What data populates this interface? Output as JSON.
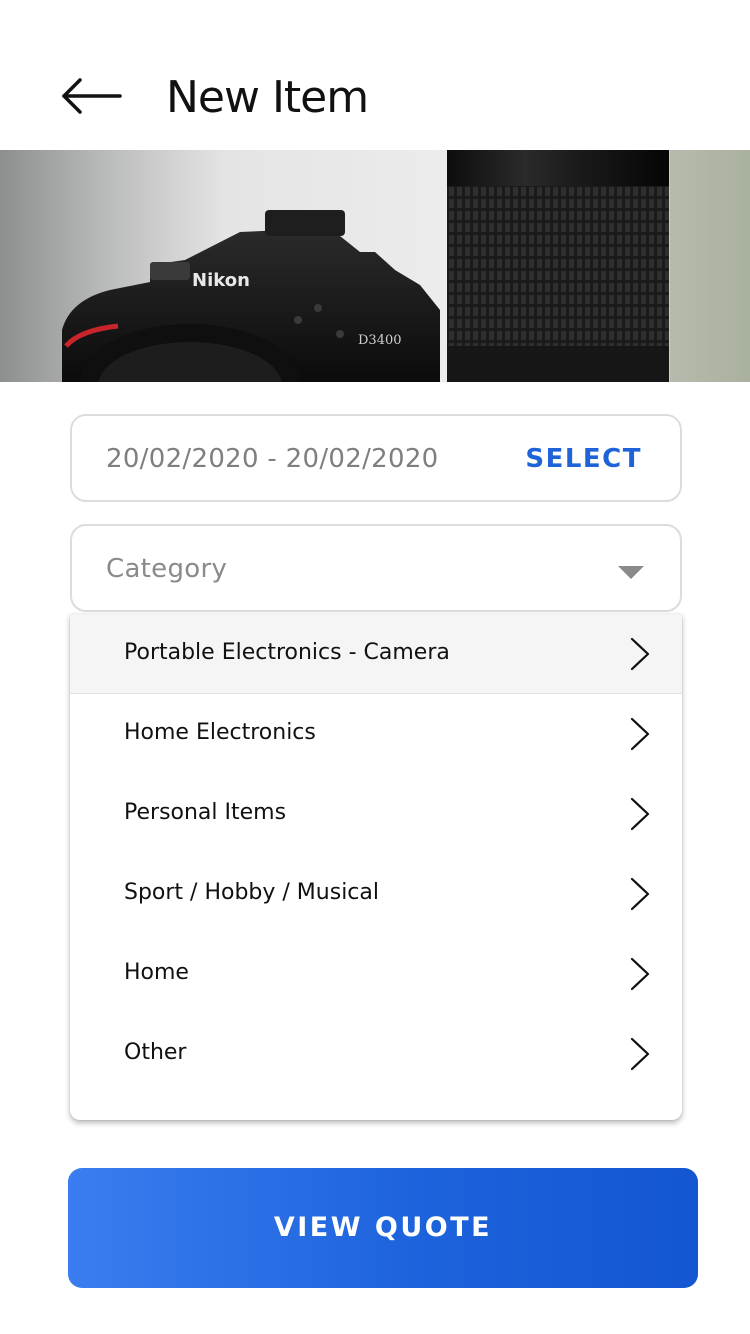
{
  "header": {
    "title": "New Item",
    "back_icon": "arrow-left-icon"
  },
  "hero": {
    "brand_text": "Nikon",
    "model_text": "D3400"
  },
  "date_field": {
    "value": "20/02/2020 - 20/02/2020",
    "select_label": "SELECT"
  },
  "category_field": {
    "placeholder": "Category",
    "icon": "caret-down-icon"
  },
  "category_options": [
    {
      "label": "Portable Electronics - Camera",
      "highlighted": true
    },
    {
      "label": "Home Electronics",
      "highlighted": false
    },
    {
      "label": "Personal Items",
      "highlighted": false
    },
    {
      "label": "Sport / Hobby / Musical",
      "highlighted": false
    },
    {
      "label": "Home",
      "highlighted": false
    },
    {
      "label": "Other",
      "highlighted": false
    }
  ],
  "cta": {
    "label": "VIEW QUOTE"
  },
  "colors": {
    "accent": "#1f63d8",
    "cta_gradient_start": "#3a7df0",
    "cta_gradient_end": "#1456d2",
    "highlight_row": "#f5f5f5"
  }
}
